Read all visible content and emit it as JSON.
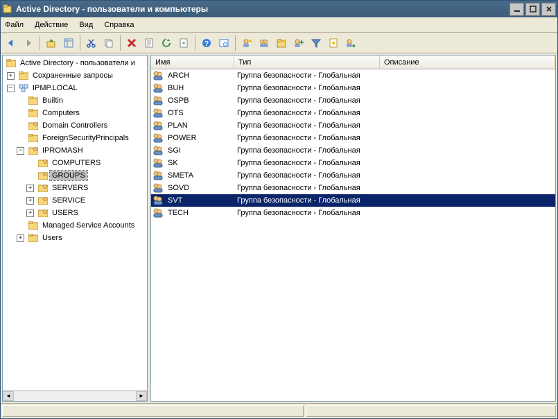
{
  "window": {
    "title": "Active Directory - пользователи и компьютеры"
  },
  "menu": {
    "file": "Файл",
    "action": "Действие",
    "view": "Вид",
    "help": "Справка"
  },
  "tree": {
    "root": "Active Directory - пользователи и",
    "saved_queries": "Сохраненные запросы",
    "domain": "IPMP.LOCAL",
    "builtin": "Builtin",
    "computers": "Computers",
    "domain_controllers": "Domain Controllers",
    "fsp": "ForeignSecurityPrincipals",
    "ipromash": "IPROMASH",
    "ou_computers": "COMPUTERS",
    "ou_groups": "GROUPS",
    "ou_servers": "SERVERS",
    "ou_service": "SERVICE",
    "ou_users": "USERS",
    "msa": "Managed Service Accounts",
    "users": "Users"
  },
  "columns": {
    "name": "Имя",
    "type": "Тип",
    "description": "Описание"
  },
  "security_group_global": "Группа безопасности - Глобальная",
  "groups": [
    {
      "name": "ARCH"
    },
    {
      "name": "BUH"
    },
    {
      "name": "OSPB"
    },
    {
      "name": "OTS"
    },
    {
      "name": "PLAN"
    },
    {
      "name": "POWER"
    },
    {
      "name": "SGI"
    },
    {
      "name": "SK"
    },
    {
      "name": "SMETA"
    },
    {
      "name": "SOVD"
    },
    {
      "name": "SVT",
      "selected": true
    },
    {
      "name": "TECH"
    }
  ],
  "col_widths": {
    "name": 120,
    "type": 210,
    "description": 230
  }
}
